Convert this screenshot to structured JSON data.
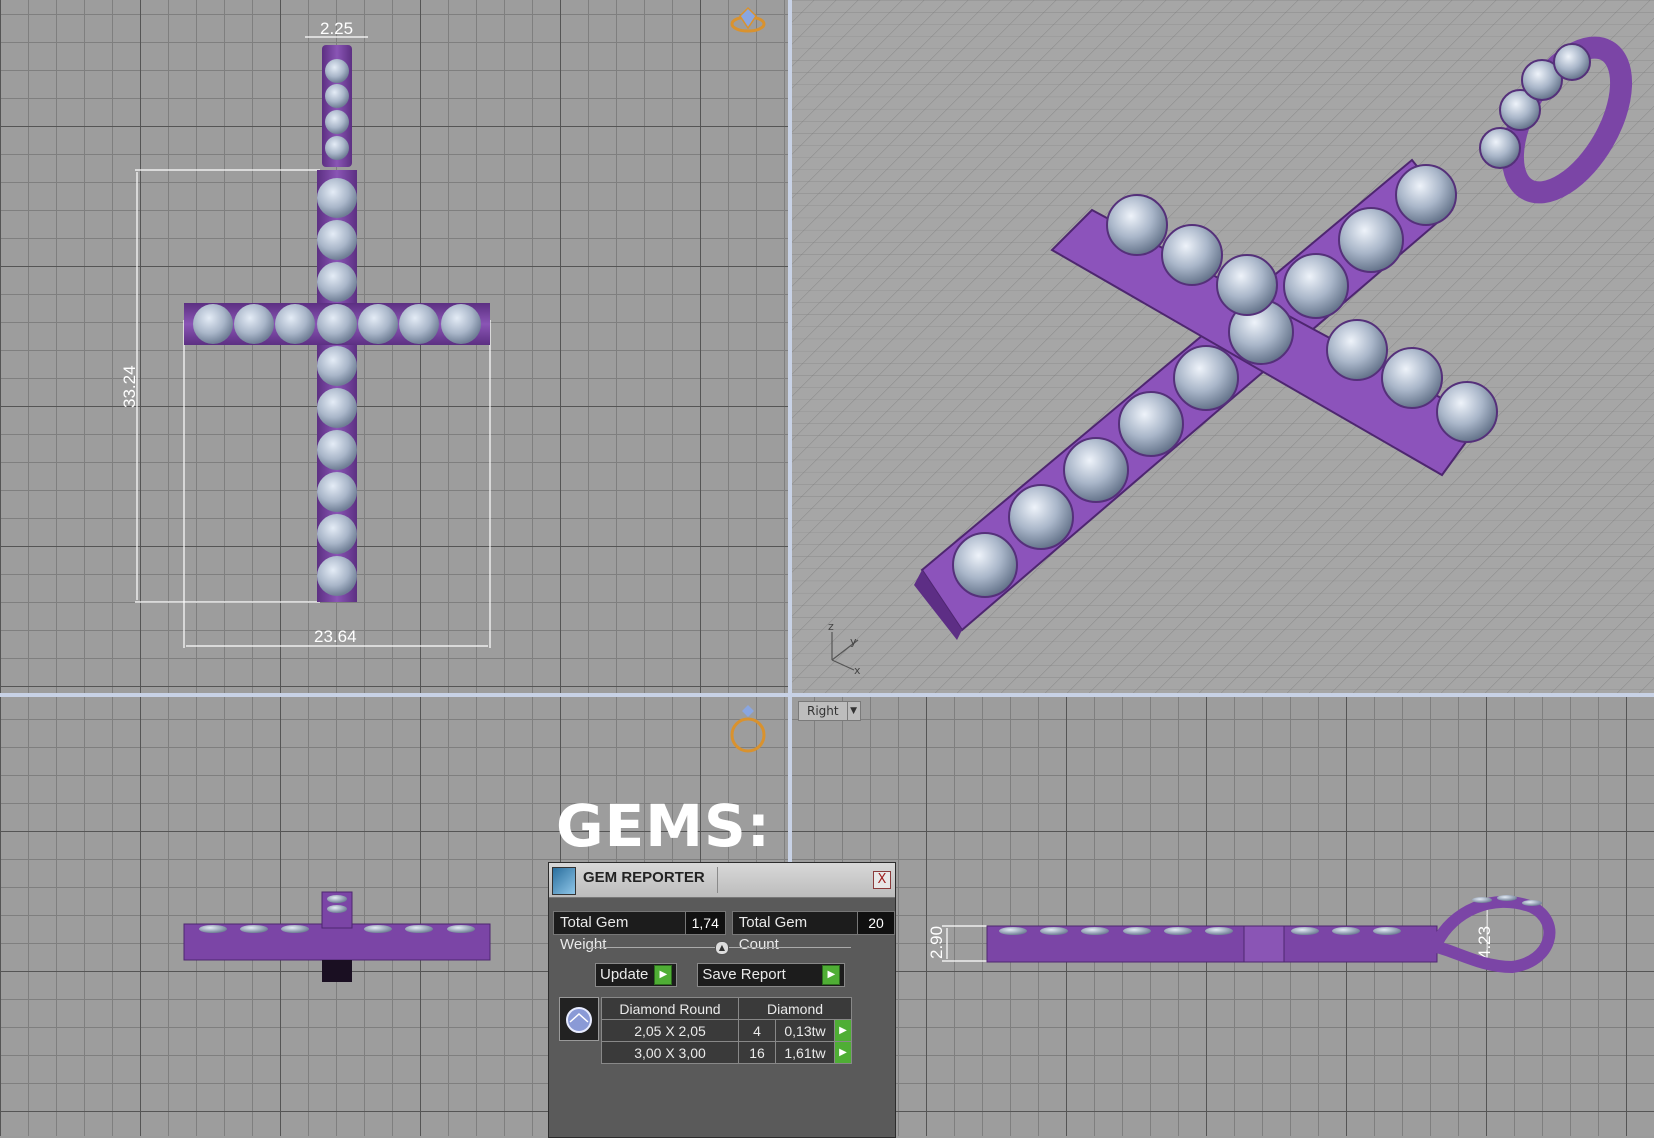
{
  "viewports": {
    "top": {
      "dimensions": {
        "width_top": "2.25",
        "height_left": "33.24",
        "width_bottom": "23.64"
      }
    },
    "front": {},
    "right": {
      "label": "Right",
      "dimensions": {
        "thickness": "2.90",
        "loop": "4.23"
      }
    },
    "perspective": {
      "axis_labels": {
        "z": "z",
        "y": "y",
        "x": "x"
      }
    }
  },
  "heading": "GEMS:",
  "gem_reporter": {
    "title": "GEM REPORTER",
    "close_label": "X",
    "total_weight_label": "Total Gem Weight",
    "total_weight_value": "1,74",
    "total_count_label": "Total Gem Count",
    "total_count_value": "20",
    "update_label": "Update",
    "save_report_label": "Save Report",
    "table": {
      "headers": [
        "Diamond Round",
        "Diamond"
      ],
      "rows": [
        {
          "size": "2,05 X 2,05",
          "count": "4",
          "weight": "0,13tw"
        },
        {
          "size": "3,00 X 3,00",
          "count": "16",
          "weight": "1,61tw"
        }
      ]
    }
  },
  "colors": {
    "metal": "#7b45a6",
    "metal_dark": "#4e2670",
    "gem": "#aab6c8",
    "viewport_bg": "#9d9d9d",
    "divider": "#c8d2e6",
    "accent_play": "#4fae35"
  }
}
